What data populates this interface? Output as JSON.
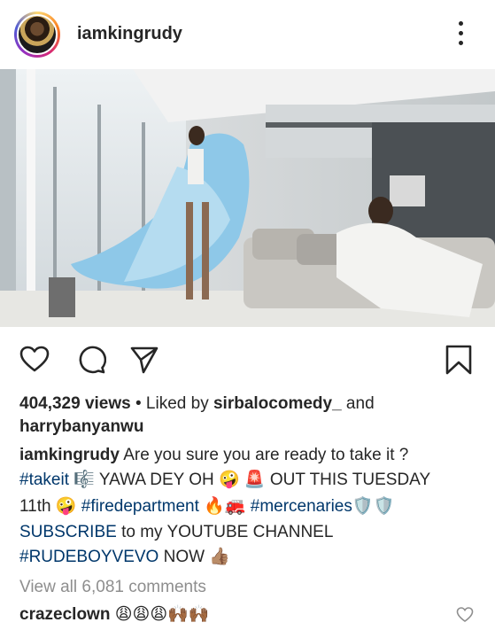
{
  "post": {
    "username": "iamkingrudy",
    "views": "404,329 views",
    "liked_by_prefix": " • Liked by ",
    "liked_by_user": "sirbalocomedy_",
    "liked_and": " and",
    "liked_by_user2": "harrybanyanwu",
    "caption_user": "iamkingrudy",
    "caption_line1": " Are you sure you are ready to take it ?",
    "hashtag_takeit": "#takeit",
    "caption_line2_rest": " 🎼 YAWA DEY OH 🤪 🚨 OUT THIS TUESDAY",
    "caption_line3_start": "11th 🤪 ",
    "hashtag_firedepartment": "#firedepartment",
    "caption_line3_mid": " 🔥🚒 ",
    "hashtag_mercenaries": "#mercenaries",
    "caption_line3_end": "🛡️🛡️",
    "subscribe": "SUBSCRIBE",
    "caption_line4_rest": " to my YOUTUBE CHANNEL",
    "hashtag_rudeboyvevo": "#RUDEBOYVEVO",
    "caption_line5_rest": " NOW 👍🏽",
    "view_all_comments": "View all 6,081 comments",
    "comment1_user": "crazeclown",
    "comment1_text": " 😩😩😩🙌🏾🙌🏾"
  },
  "icons": {
    "more": "more-vertical-icon",
    "like": "heart-outline-icon",
    "comment": "comment-bubble-icon",
    "share": "paper-plane-icon",
    "save": "bookmark-icon",
    "comment_like": "heart-outline-icon"
  },
  "colors": {
    "link": "#00376b",
    "muted": "#8e8e8e",
    "text": "#262626"
  }
}
